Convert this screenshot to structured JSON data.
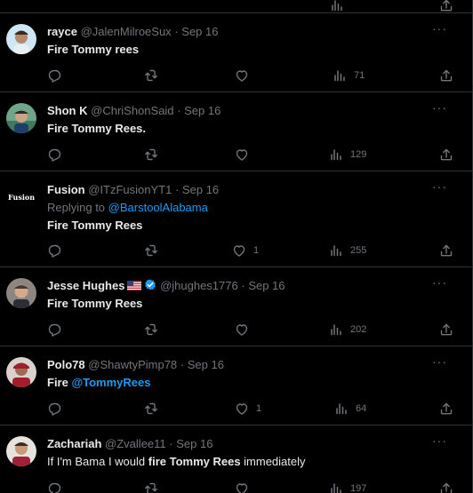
{
  "tweets": [
    {
      "name": "rayce",
      "handle": "@JalenMilroeSux",
      "sep": "·",
      "date": "Sep 16",
      "text": "Fire Tommy rees",
      "likes": "",
      "views": "71",
      "avatar_color": "#cfe6f5"
    },
    {
      "name": "Shon K",
      "handle": "@ChriShonSaid",
      "sep": "·",
      "date": "Sep 16",
      "text": "Fire Tommy Rees.",
      "likes": "",
      "views": "129",
      "avatar_color": "#3f7a5d"
    },
    {
      "name": "Fusion",
      "handle": "@ITzFusionYT1",
      "sep": "·",
      "date": "Sep 16",
      "reply_prefix": "Replying to ",
      "reply_handle": "@BarstoolAlabama",
      "text": "Fire Tommy Rees",
      "likes": "1",
      "views": "255",
      "avatar_text": "Fusion",
      "avatar_color": "#000000"
    },
    {
      "name": "Jesse Hughes",
      "handle": "@jhughes1776",
      "sep": "·",
      "date": "Sep 16",
      "text": "Fire Tommy Rees",
      "likes": "",
      "views": "202",
      "avatar_color": "#7a6b63"
    },
    {
      "name": "Polo78",
      "handle": "@ShawtyPimp78",
      "sep": "·",
      "date": "Sep 16",
      "text_prefix": "Fire ",
      "text_link": "@TommyRees",
      "likes": "1",
      "views": "64",
      "avatar_color": "#a01f2a"
    },
    {
      "name": "Zachariah",
      "handle": "@Zvallee11",
      "sep": "·",
      "date": "Sep 16",
      "text_a": "If I'm Bama I would ",
      "text_b": "fire Tommy Rees",
      "text_c": " immediately",
      "likes": "",
      "views": "197",
      "avatar_color": "#9b2335"
    }
  ],
  "colors": {
    "background": "#000000",
    "text": "#e7e9ea",
    "muted": "#71767b",
    "link": "#1d9bf0",
    "divider": "#2f3336"
  },
  "icons": [
    "more-icon",
    "reply-icon",
    "retweet-icon",
    "like-icon",
    "views-icon",
    "share-icon",
    "verified-icon",
    "us-flag-icon"
  ]
}
